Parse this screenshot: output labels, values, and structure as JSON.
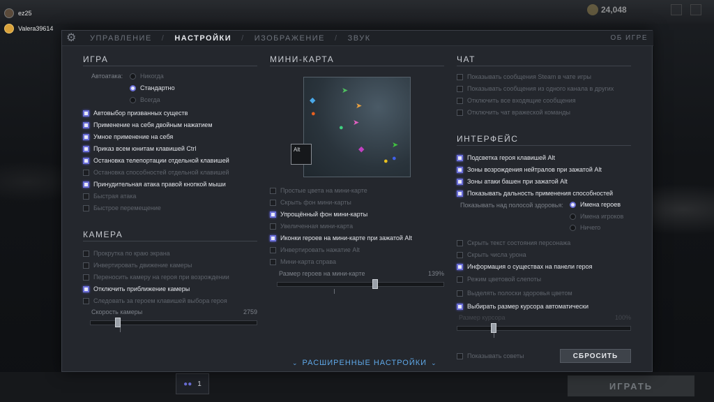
{
  "friends": [
    {
      "name": "ez25"
    },
    {
      "name": "Valera39614"
    }
  ],
  "coins": {
    "value": "24,048"
  },
  "play_button": "ИГРАТЬ",
  "party": {
    "count": "1"
  },
  "tabs": [
    {
      "label": "УПРАВЛЕНИЕ"
    },
    {
      "label": "НАСТРОЙКИ"
    },
    {
      "label": "ИЗОБРАЖЕНИЕ"
    },
    {
      "label": "ЗВУК"
    }
  ],
  "about": "ОБ ИГРЕ",
  "game": {
    "title": "ИГРА",
    "autoattack_label": "Автоатака:",
    "autoattack_options": [
      "Никогда",
      "Стандартно",
      "Всегда"
    ],
    "options": [
      {
        "label": "Автовыбор призванных существ",
        "on": true
      },
      {
        "label": "Применение на себя двойным нажатием",
        "on": true
      },
      {
        "label": "Умное применение на себя",
        "on": true
      },
      {
        "label": "Приказ всем юнитам клавишей Ctrl",
        "on": true
      },
      {
        "label": "Остановка телепортации отдельной клавишей",
        "on": true
      },
      {
        "label": "Остановка способностей отдельной клавишей",
        "on": false
      },
      {
        "label": "Принудительная атака правой кнопкой мыши",
        "on": true
      },
      {
        "label": "Быстрая атака",
        "on": false
      },
      {
        "label": "Быстрое перемещение",
        "on": false
      }
    ]
  },
  "camera": {
    "title": "КАМЕРА",
    "options": [
      {
        "label": "Прокрутка по краю экрана",
        "on": false
      },
      {
        "label": "Инвертировать движение камеры",
        "on": false
      },
      {
        "label": "Переносить камеру на героя при возрождении",
        "on": false
      },
      {
        "label": "Отключить приближение камеры",
        "on": true
      },
      {
        "label": "Следовать за героем клавишей выбора героя",
        "on": false
      }
    ],
    "speed_label": "Скорость камеры",
    "speed_value": "2759",
    "speed_fraction": 0.15
  },
  "minimap": {
    "title": "МИНИ-КАРТА",
    "alt_key": "Alt",
    "options": [
      {
        "label": "Простые цвета на мини-карте",
        "on": false
      },
      {
        "label": "Скрыть фон мини-карты",
        "on": false
      },
      {
        "label": "Упрощённый фон мини-карты",
        "on": true
      },
      {
        "label": "Увеличенная мини-карта",
        "on": false
      },
      {
        "label": "Иконки героев на мини-карте при зажатой Alt",
        "on": true
      },
      {
        "label": "Инвертировать нажатие Alt",
        "on": false
      },
      {
        "label": "Мини-карта справа",
        "on": false
      }
    ],
    "hero_size_label": "Размер героев на мини-карте",
    "hero_size_value": "139%",
    "hero_size_fraction": 0.59
  },
  "chat": {
    "title": "ЧАТ",
    "options": [
      {
        "label": "Показывать сообщения Steam в чате игры",
        "on": false
      },
      {
        "label": "Показывать сообщения из одного канала в других",
        "on": false
      },
      {
        "label": "Отключить все входящие сообщения",
        "on": false
      },
      {
        "label": "Отключить чат вражеской команды",
        "on": false
      }
    ]
  },
  "interface": {
    "title": "ИНТЕРФЕЙС",
    "options_top": [
      {
        "label": "Подсветка героя клавишей Alt",
        "on": true
      },
      {
        "label": "Зоны возрождения нейтралов при зажатой Alt",
        "on": true
      },
      {
        "label": "Зоны атаки башен при зажатой Alt",
        "on": true
      },
      {
        "label": "Показывать дальность применения способностей",
        "on": true
      }
    ],
    "healthbar_label": "Показывать над полосой здоровья:",
    "healthbar_options": [
      "Имена героев",
      "Имена игроков",
      "Ничего"
    ],
    "options_bottom": [
      {
        "label": "Скрыть текст состояния персонажа",
        "on": false
      },
      {
        "label": "Скрыть числа урона",
        "on": false
      },
      {
        "label": "Информация о существах на панели героя",
        "on": true
      },
      {
        "label": "Режим цветовой слепоты",
        "on": false
      },
      {
        "label": "Выделять полоски здоровья цветом",
        "on": false
      },
      {
        "label": "Выбирать размер курсора автоматически",
        "on": true
      }
    ],
    "cursor_size_label": "Размер курсора",
    "cursor_size_value": "100%",
    "cursor_size_fraction": 0.2,
    "show_tips_label": "Показывать советы",
    "reset_label": "СБРОСИТЬ"
  },
  "advanced_label": "РАСШИРЕННЫЕ НАСТРОЙКИ",
  "colors": {
    "accent": "#6b6fd8",
    "link": "#5fa8e8"
  }
}
